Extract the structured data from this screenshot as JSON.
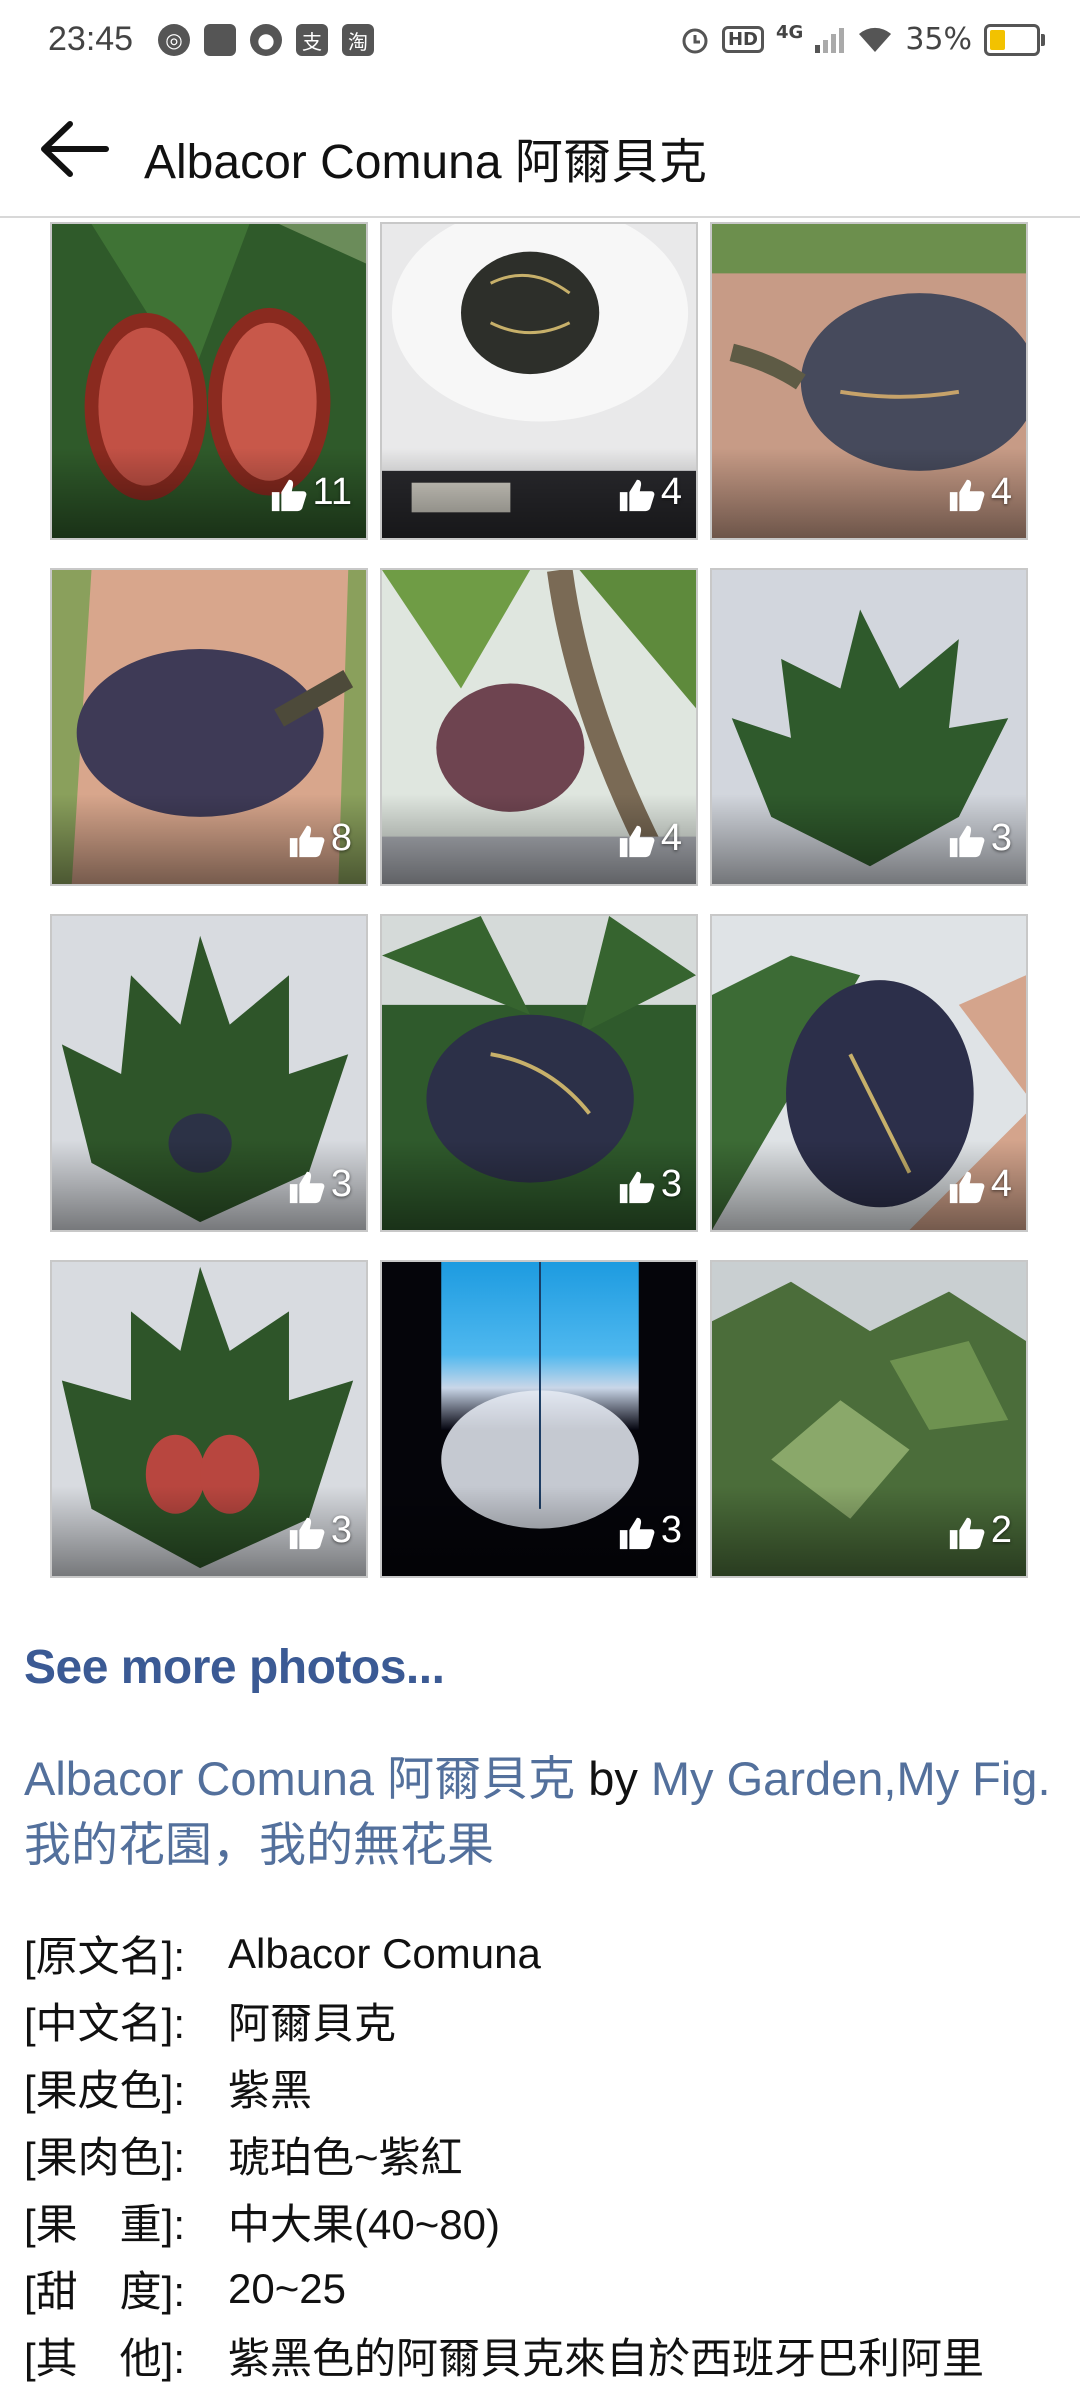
{
  "status_bar": {
    "time": "23:45",
    "battery_pct": "35%",
    "hd": "HD",
    "network": "4G",
    "battery_level": 0.35
  },
  "app_bar": {
    "title": "Albacor Comuna 阿爾貝克"
  },
  "photos": [
    {
      "likes": "11"
    },
    {
      "likes": "4"
    },
    {
      "likes": "4"
    },
    {
      "likes": "8"
    },
    {
      "likes": "4"
    },
    {
      "likes": "3"
    },
    {
      "likes": "3"
    },
    {
      "likes": "3"
    },
    {
      "likes": "4"
    },
    {
      "likes": "3"
    },
    {
      "likes": "3"
    },
    {
      "likes": "2"
    }
  ],
  "see_more": "See more photos...",
  "intro": {
    "link1": "Albacor Comuna 阿爾貝克",
    "by": " by ",
    "link2": "My Garden,My Fig. 我的花園，我的無花果"
  },
  "details": [
    {
      "key": "[原文名]:",
      "value": "Albacor Comuna"
    },
    {
      "key": "[中文名]:",
      "value": "阿爾貝克"
    },
    {
      "key": "[果皮色]:",
      "value": "紫黑"
    },
    {
      "key": "[果肉色]:",
      "value": "琥珀色~紫紅"
    },
    {
      "key": "[果　重]:",
      "value": "中大果(40~80)"
    },
    {
      "key": "[甜　度]:",
      "value": "20~25"
    },
    {
      "key": "[其　他]:",
      "value": "紫黑色的阿爾貝克來自於西班牙巴利阿里"
    }
  ],
  "icons": [
    "back-arrow-icon",
    "thumbs-up-icon",
    "alarm-icon",
    "wifi-icon",
    "battery-icon",
    "signal-icon"
  ],
  "colors": {
    "link": "#3b5a94",
    "link_text": "#53709c",
    "battery": "#f2c200"
  }
}
